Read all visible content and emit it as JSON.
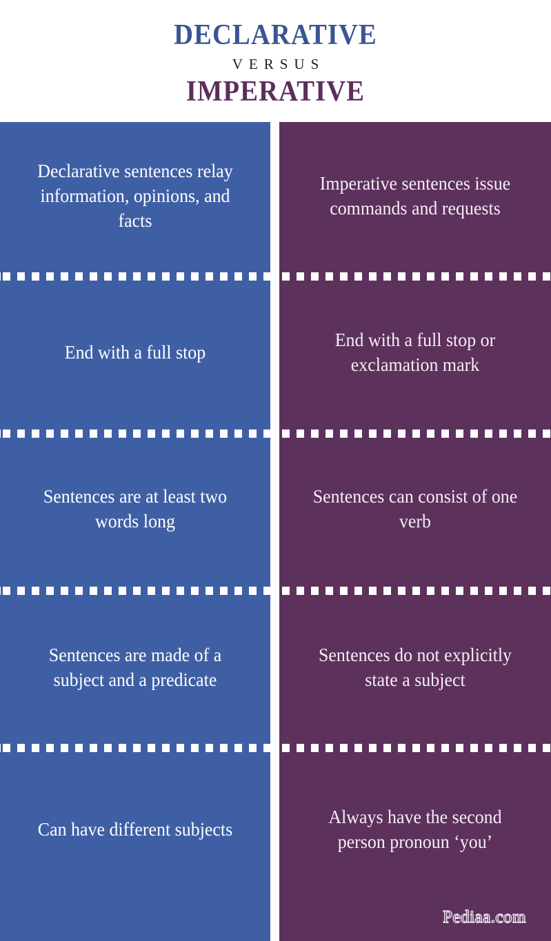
{
  "header": {
    "title_main": "DECLARATIVE",
    "title_versus": "VERSUS",
    "title_sub": "IMPERATIVE"
  },
  "colors": {
    "left_panel": "#3F5FA5",
    "right_panel": "#5C315C",
    "title_main": "#3A5593",
    "title_sub": "#5C2E5C",
    "versus": "#1b1b22",
    "dash": "#ffffff",
    "background": "#ffffff"
  },
  "comparison": {
    "left_label": "DECLARATIVE",
    "right_label": "IMPERATIVE",
    "rows": [
      {
        "left": "Declarative sentences relay information, opinions, and facts",
        "right": "Imperative sentences issue commands and requests"
      },
      {
        "left": "End with a full stop",
        "right": "End with a full stop or exclamation mark"
      },
      {
        "left": "Sentences are at least two words long",
        "right": "Sentences can consist of one verb"
      },
      {
        "left": "Sentences are made of a subject and a predicate",
        "right": "Sentences do not explicitly state a subject"
      },
      {
        "left": "Can have different subjects",
        "right": "Always have the second person pronoun ‘you’"
      }
    ]
  },
  "watermark": {
    "text": "Pediaa.com"
  }
}
